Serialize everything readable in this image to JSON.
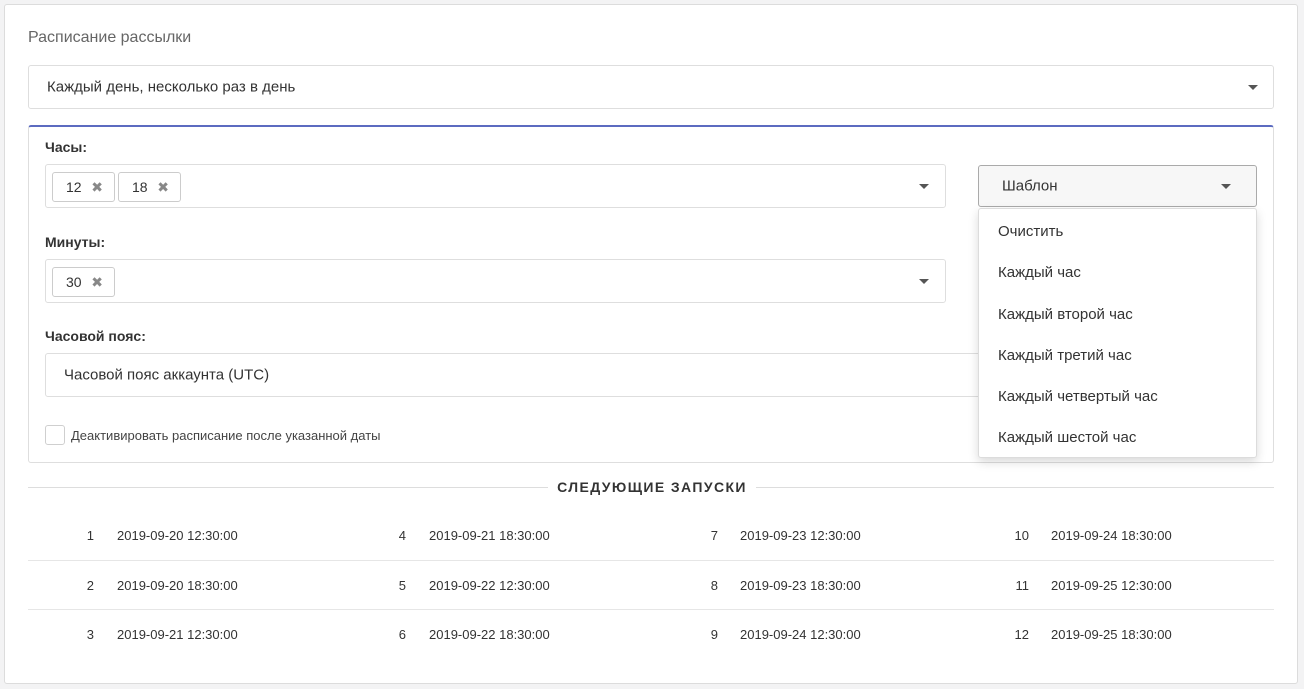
{
  "schedule": {
    "title": "Расписание рассылки",
    "mode": "Каждый день, несколько раз в день"
  },
  "hours": {
    "label": "Часы:",
    "tags": [
      "12",
      "18"
    ]
  },
  "minutes": {
    "label": "Минуты:",
    "tags": [
      "30"
    ]
  },
  "timezone": {
    "label": "Часовой пояс:",
    "value": "Часовой пояс аккаунта (UTC)"
  },
  "deactivate": {
    "label": "Деактивировать расписание после указанной даты",
    "checked": false
  },
  "template": {
    "button_label": "Шаблон",
    "options": [
      "Очистить",
      "Каждый час",
      "Каждый второй час",
      "Каждый третий час",
      "Каждый четвертый час",
      "Каждый шестой час"
    ]
  },
  "tag_remove_glyph": "✖",
  "next_runs": {
    "title": "СЛЕДУЮЩИЕ ЗАПУСКИ",
    "items": [
      {
        "index": "1",
        "time": "2019-09-20 12:30:00"
      },
      {
        "index": "2",
        "time": "2019-09-20 18:30:00"
      },
      {
        "index": "3",
        "time": "2019-09-21 12:30:00"
      },
      {
        "index": "4",
        "time": "2019-09-21 18:30:00"
      },
      {
        "index": "5",
        "time": "2019-09-22 12:30:00"
      },
      {
        "index": "6",
        "time": "2019-09-22 18:30:00"
      },
      {
        "index": "7",
        "time": "2019-09-23 12:30:00"
      },
      {
        "index": "8",
        "time": "2019-09-23 18:30:00"
      },
      {
        "index": "9",
        "time": "2019-09-24 12:30:00"
      },
      {
        "index": "10",
        "time": "2019-09-24 18:30:00"
      },
      {
        "index": "11",
        "time": "2019-09-25 12:30:00"
      },
      {
        "index": "12",
        "time": "2019-09-25 18:30:00"
      }
    ]
  },
  "colors": {
    "accent": "#5c6bc0",
    "border": "#dedede"
  }
}
